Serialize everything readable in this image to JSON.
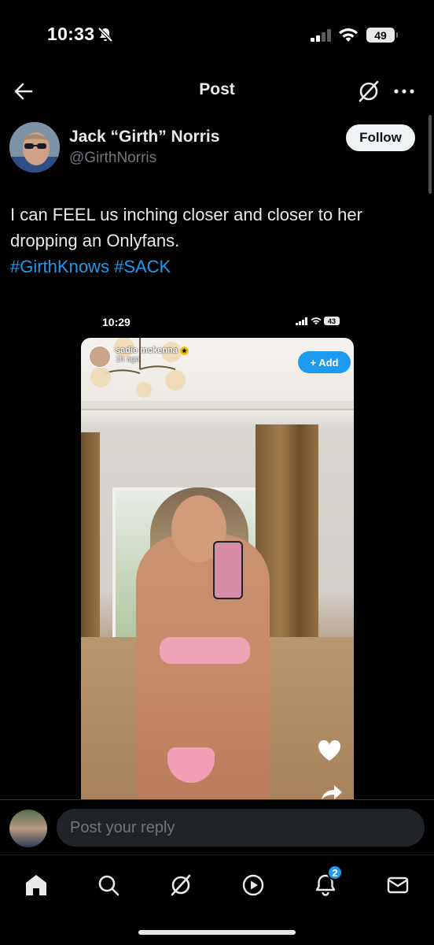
{
  "status_bar": {
    "time": "10:33",
    "battery": "49"
  },
  "header": {
    "title": "Post"
  },
  "author": {
    "name": "Jack “Girth” Norris",
    "handle": "@GirthNorris",
    "follow_label": "Follow"
  },
  "tweet": {
    "text": "I can FEEL us inching closer and closer to her dropping an Onlyfans.",
    "hashtags": [
      "#GirthKnows",
      "#SACK"
    ]
  },
  "media": {
    "inner_status": {
      "time": "10:29",
      "battery": "43"
    },
    "story_user": "sadie mckenna",
    "story_time": "1h ago",
    "add_label": "+ Add"
  },
  "reply": {
    "placeholder": "Post your reply"
  },
  "tabs": [
    {
      "name": "home-icon"
    },
    {
      "name": "search-icon"
    },
    {
      "name": "grok-icon"
    },
    {
      "name": "video-icon"
    },
    {
      "name": "notifications-icon",
      "badge": "2"
    },
    {
      "name": "messages-icon"
    }
  ],
  "colors": {
    "accent": "#1d9bf0",
    "background": "#000000",
    "text": "#e7e9ea",
    "secondary": "#71767b"
  }
}
